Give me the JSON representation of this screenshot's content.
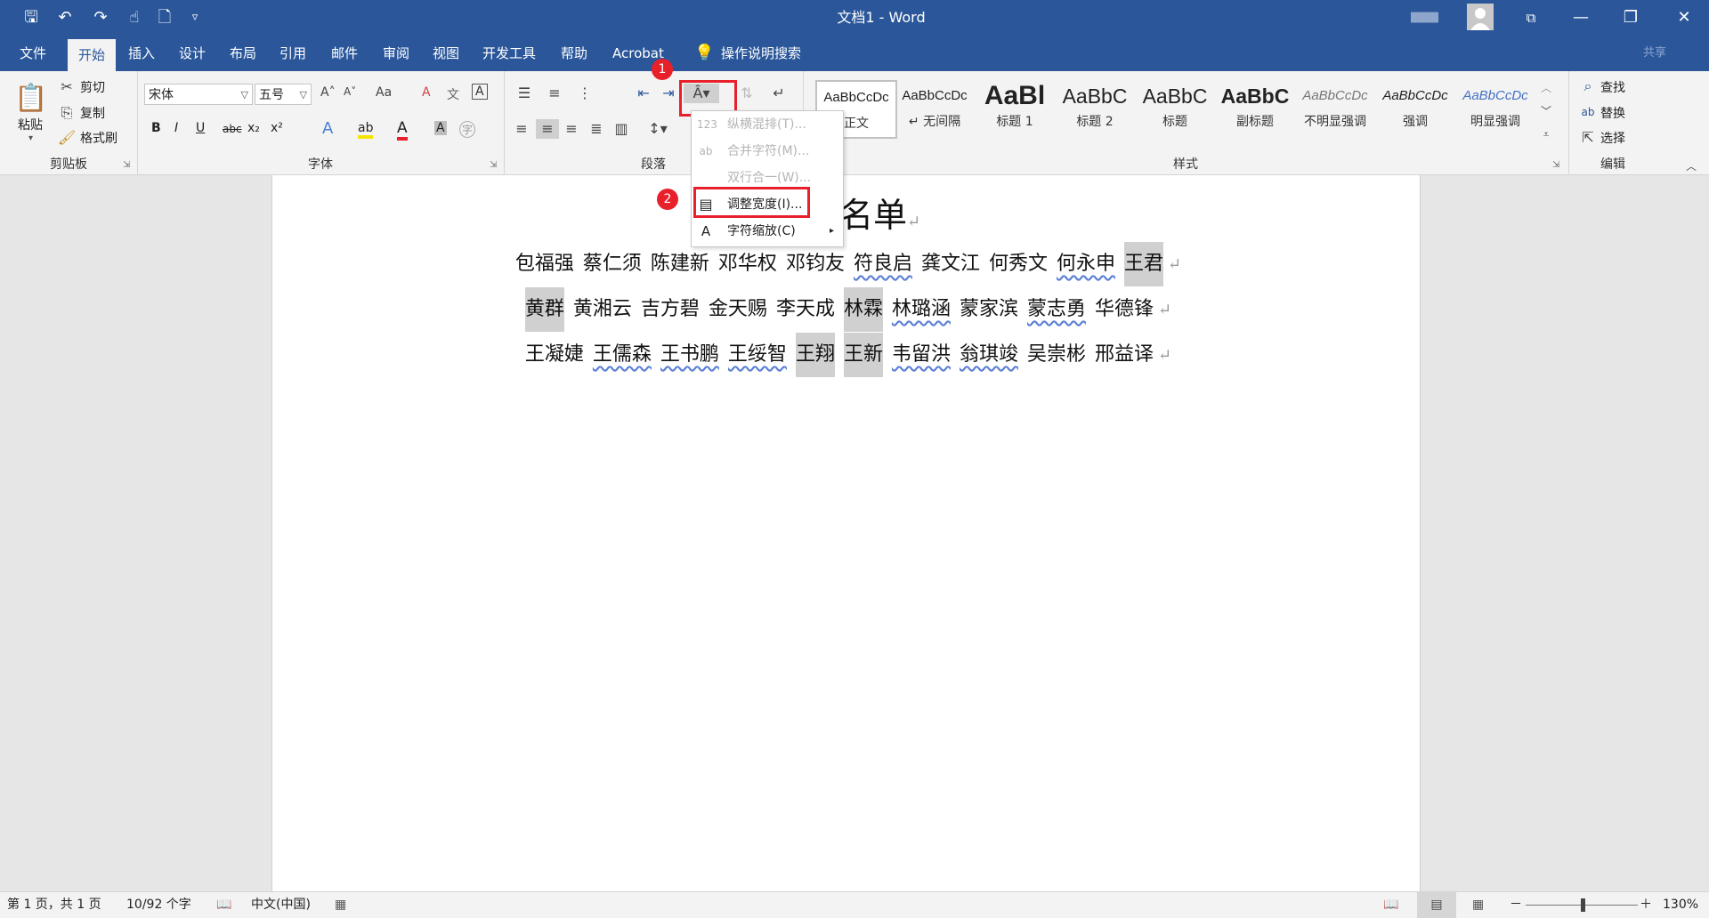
{
  "window": {
    "title": "文档1  -  Word",
    "user_blur": "████",
    "buttons": {
      "ribbon_display": "⧉",
      "minimize": "—",
      "restore": "❐",
      "close": "✕"
    }
  },
  "quick_access": {
    "save": "🖫",
    "undo": "↶",
    "redo": "↷",
    "touch": "☝",
    "preview": "🗋",
    "customize": "▿"
  },
  "tabs": [
    "文件",
    "开始",
    "插入",
    "设计",
    "布局",
    "引用",
    "邮件",
    "审阅",
    "视图",
    "开发工具",
    "帮助",
    "Acrobat"
  ],
  "active_tab": "开始",
  "tell_me": "操作说明搜索",
  "share": "共享",
  "clipboard": {
    "paste": "粘贴",
    "cut": "剪切",
    "copy": "复制",
    "format_painter": "格式刷",
    "label": "剪贴板"
  },
  "font": {
    "name": "宋体",
    "size": "五号",
    "label": "字体",
    "bold": "B",
    "italic": "I",
    "underline": "U",
    "strike": "abc",
    "sub": "x₂",
    "sup": "x²",
    "grow": "A˄",
    "shrink": "A˅",
    "case": "Aa",
    "clear": "A",
    "phonetic": "文",
    "border": "A",
    "effects": "A",
    "highlight": "ab",
    "color": "A",
    "shade": "A",
    "enclose": "字"
  },
  "paragraph": {
    "label": "段落"
  },
  "styles": {
    "label": "样式",
    "items": [
      {
        "preview": "AaBbCcDc",
        "name": "正文"
      },
      {
        "preview": "AaBbCcDc",
        "name": "↵ 无间隔"
      },
      {
        "preview": "AaBl",
        "name": "标题 1"
      },
      {
        "preview": "AaBbC",
        "name": "标题 2"
      },
      {
        "preview": "AaBbC",
        "name": "标题"
      },
      {
        "preview": "AaBbC",
        "name": "副标题"
      },
      {
        "preview": "AaBbCcDc",
        "name": "不明显强调"
      },
      {
        "preview": "AaBbCcDc",
        "name": "强调"
      },
      {
        "preview": "AaBbCcDc",
        "name": "明显强调"
      }
    ]
  },
  "editing": {
    "find": "查找",
    "replace": "替换",
    "select": "选择",
    "label": "编辑"
  },
  "badges": {
    "one": "1",
    "two": "2"
  },
  "menu": {
    "items": [
      {
        "icon": "123",
        "label": "纵横混排(T)...",
        "disabled": true
      },
      {
        "icon": "ab",
        "label": "合并字符(M)...",
        "disabled": true
      },
      {
        "icon": "",
        "label": "双行合一(W)...",
        "disabled": true
      },
      {
        "icon": "▤",
        "label": "调整宽度(I)...",
        "disabled": false
      },
      {
        "icon": "A",
        "label": "字符缩放(C)",
        "disabled": false
      }
    ]
  },
  "document": {
    "title": "人员名单",
    "para_mark": "↵",
    "lines": [
      [
        {
          "t": "包福强"
        },
        {
          "t": "蔡仁须"
        },
        {
          "t": "陈建新"
        },
        {
          "t": "邓华权"
        },
        {
          "t": "邓钧友"
        },
        {
          "t": "符良启",
          "sq": true
        },
        {
          "t": "龚文江"
        },
        {
          "t": "何秀文"
        },
        {
          "t": "何永申",
          "sq": true
        },
        {
          "t": "王君",
          "hl": true
        }
      ],
      [
        {
          "t": "黄群",
          "hl": true
        },
        {
          "t": "黄湘云"
        },
        {
          "t": "吉方碧"
        },
        {
          "t": "金天赐"
        },
        {
          "t": "李天成"
        },
        {
          "t": "林霖",
          "hl": true
        },
        {
          "t": "林璐涵",
          "sq": true
        },
        {
          "t": "蒙家滨"
        },
        {
          "t": "蒙志勇",
          "sq": true
        },
        {
          "t": "华德锋"
        }
      ],
      [
        {
          "t": "王凝婕"
        },
        {
          "t": "王儒森",
          "sq": true
        },
        {
          "t": "王书鹏",
          "sq": true
        },
        {
          "t": "王绥智",
          "sq": true
        },
        {
          "t": "王翔",
          "hl": true
        },
        {
          "t": "王新",
          "hl": true
        },
        {
          "t": "韦留洪",
          "sq": true
        },
        {
          "t": "翁琪竣",
          "sq": true
        },
        {
          "t": "吴崇彬"
        },
        {
          "t": "邢益译"
        }
      ]
    ]
  },
  "status": {
    "page": "第 1 页，共 1 页",
    "words": "10/92 个字",
    "lang": "中文(中国)",
    "zoom": "130%",
    "minus": "－",
    "plus": "＋"
  },
  "colors": {
    "brand": "#2b579a",
    "red": "#e8202a",
    "highlight": "#d0d0d0"
  }
}
